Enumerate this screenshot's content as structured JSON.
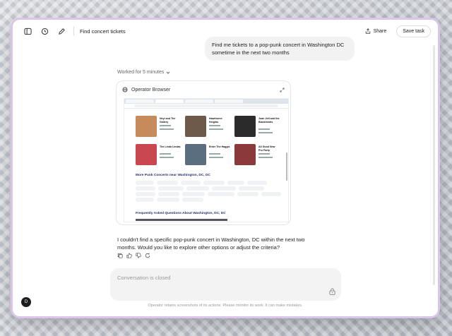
{
  "header": {
    "title": "Find concert tickets",
    "share_label": "Share",
    "save_label": "Save task",
    "icons": [
      "sidebar-icon",
      "history-icon",
      "edit-icon",
      "share-icon"
    ]
  },
  "chat": {
    "user_message": "Find me tickets to a pop-punk concert in Washington DC sometime in the next two months",
    "worked_label": "Worked for 5 minutes",
    "operator_title": "Operator Browser",
    "assistant_message": "I couldn't find a specific pop-punk concert in Washington, DC within the next two months. Would you like to explore other options or adjust the criteria?",
    "response_actions": [
      "copy-icon",
      "thumbs-up-icon",
      "thumbs-down-icon",
      "retry-icon"
    ]
  },
  "browser": {
    "section_more": "More Punk Concerts near Washington, DC, DC",
    "section_faq": "Frequently Asked Questions About Washington, DC, DC",
    "concerts": [
      {
        "title": "Neyl and The Gallery",
        "color": "#c78a5a"
      },
      {
        "title": "Hawthorne Heights",
        "color": "#6e5a4a"
      },
      {
        "title": "Joan Jett and the Blackhearts",
        "color": "#2b2b2b"
      },
      {
        "title": "The Linda Lindas",
        "color": "#c9474f"
      },
      {
        "title": "Enter The Haggis",
        "color": "#5a6e80"
      },
      {
        "title": "All Good New Pro Party",
        "color": "#8a3a3a"
      }
    ]
  },
  "composer": {
    "placeholder": "Conversation is closed"
  },
  "footer": {
    "disclaimer": "Operator retains screenshots of its actions. Please monitor its work. It can make mistakes."
  },
  "user": {
    "avatar_initial": "D"
  },
  "colors": {
    "accent": "#2b2f6b",
    "frame_glow": "#d9c6e8"
  }
}
